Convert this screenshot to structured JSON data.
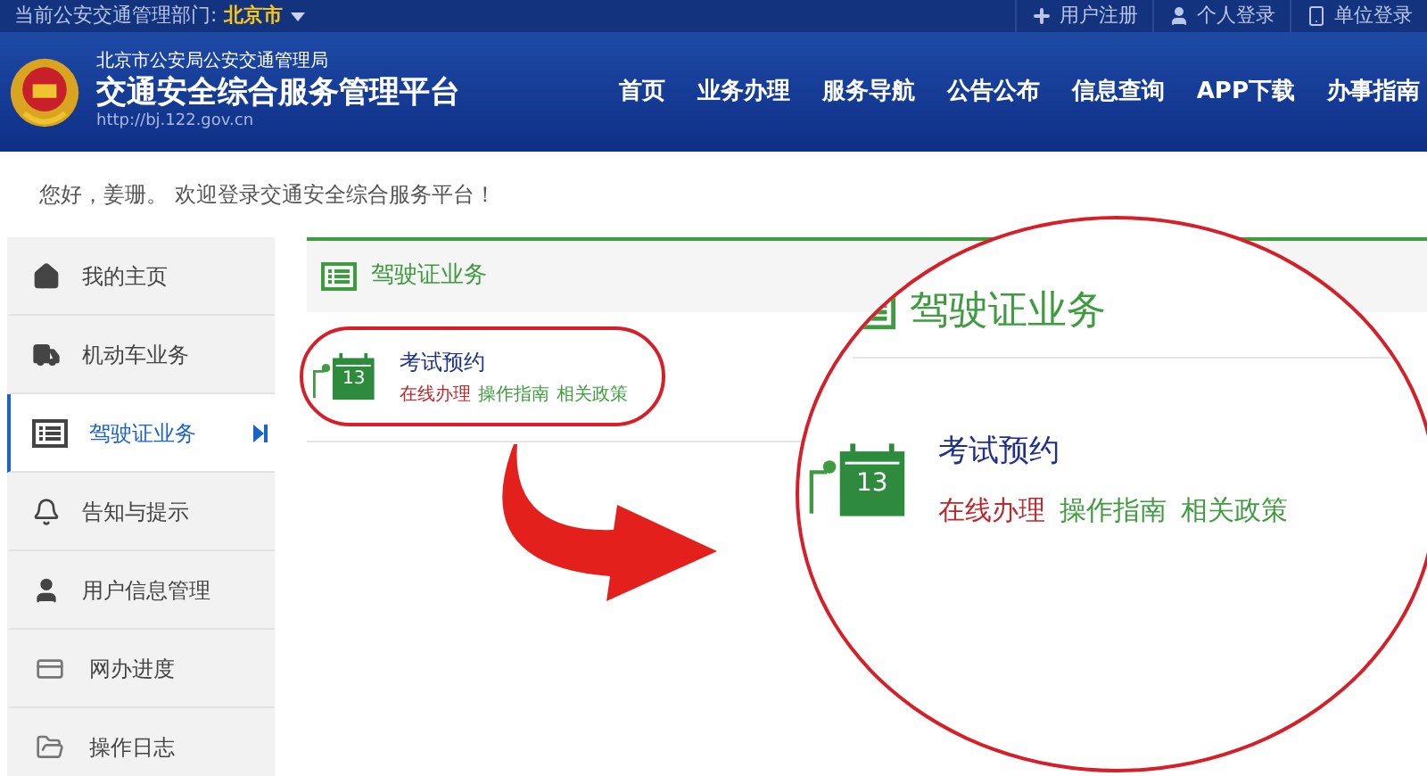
{
  "top_bar": {
    "label": "当前公安交通管理部门:",
    "city": "北京市",
    "links": [
      {
        "kind": "register",
        "label": "用户注册"
      },
      {
        "kind": "personal",
        "label": "个人登录"
      },
      {
        "kind": "unit",
        "label": "单位登录"
      }
    ]
  },
  "header": {
    "org": "北京市公安局公安交通管理局",
    "title": "交通安全综合服务管理平台",
    "url": "http://bj.122.gov.cn",
    "nav": [
      "首页",
      "业务办理",
      "服务导航",
      "公告公布",
      "信息查询",
      "APP下载",
      "办事指南"
    ]
  },
  "welcome": "您好，姜珊。 欢迎登录交通安全综合服务平台！",
  "sidebar": {
    "items": [
      {
        "kind": "home",
        "label": "我的主页",
        "selected": false
      },
      {
        "kind": "truck",
        "label": "机动车业务",
        "selected": false
      },
      {
        "kind": "list",
        "label": "驾驶证业务",
        "selected": true
      },
      {
        "kind": "bell",
        "label": "告知与提示",
        "selected": false
      },
      {
        "kind": "user",
        "label": "用户信息管理",
        "selected": false
      },
      {
        "kind": "card",
        "label": "网办进度",
        "selected": false
      },
      {
        "kind": "folder",
        "label": "操作日志",
        "selected": false
      }
    ]
  },
  "panel": {
    "title": "驾驶证业务",
    "services": [
      {
        "title": "考试预约",
        "day": "13",
        "links": [
          {
            "kind": "primary",
            "label": "在线办理"
          },
          {
            "kind": "secondary",
            "label": "操作指南"
          },
          {
            "kind": "secondary",
            "label": "相关政策"
          }
        ]
      }
    ]
  },
  "magnifier": {
    "title": "驾驶证业务",
    "service": {
      "title": "考试预约",
      "day": "13",
      "links": [
        {
          "kind": "primary",
          "label": "在线办理"
        },
        {
          "kind": "secondary",
          "label": "操作指南"
        },
        {
          "kind": "secondary",
          "label": "相关政策"
        }
      ]
    }
  }
}
